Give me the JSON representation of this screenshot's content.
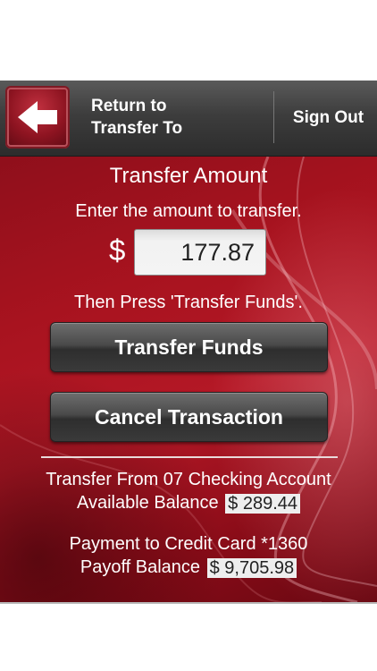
{
  "header": {
    "back_label_line1": "Return to",
    "back_label_line2": "Transfer To",
    "sign_out": "Sign Out"
  },
  "transfer": {
    "title": "Transfer Amount",
    "instruction": "Enter the amount to transfer.",
    "currency_symbol": "$",
    "amount": "177.87",
    "then_press": "Then Press 'Transfer Funds'."
  },
  "buttons": {
    "transfer_funds": "Transfer Funds",
    "cancel_transaction": "Cancel Transaction"
  },
  "from_account": {
    "label": "Transfer From 07 Checking Account",
    "balance_label": "Available Balance",
    "balance": "$ 289.44"
  },
  "to_account": {
    "label": "Payment to Credit Card *1360",
    "balance_label": "Payoff Balance",
    "balance": "$ 9,705.98"
  },
  "colors": {
    "background_red": "#a8131f",
    "header_gray": "#3d3d3d",
    "button_dark": "#4a4a4a"
  }
}
